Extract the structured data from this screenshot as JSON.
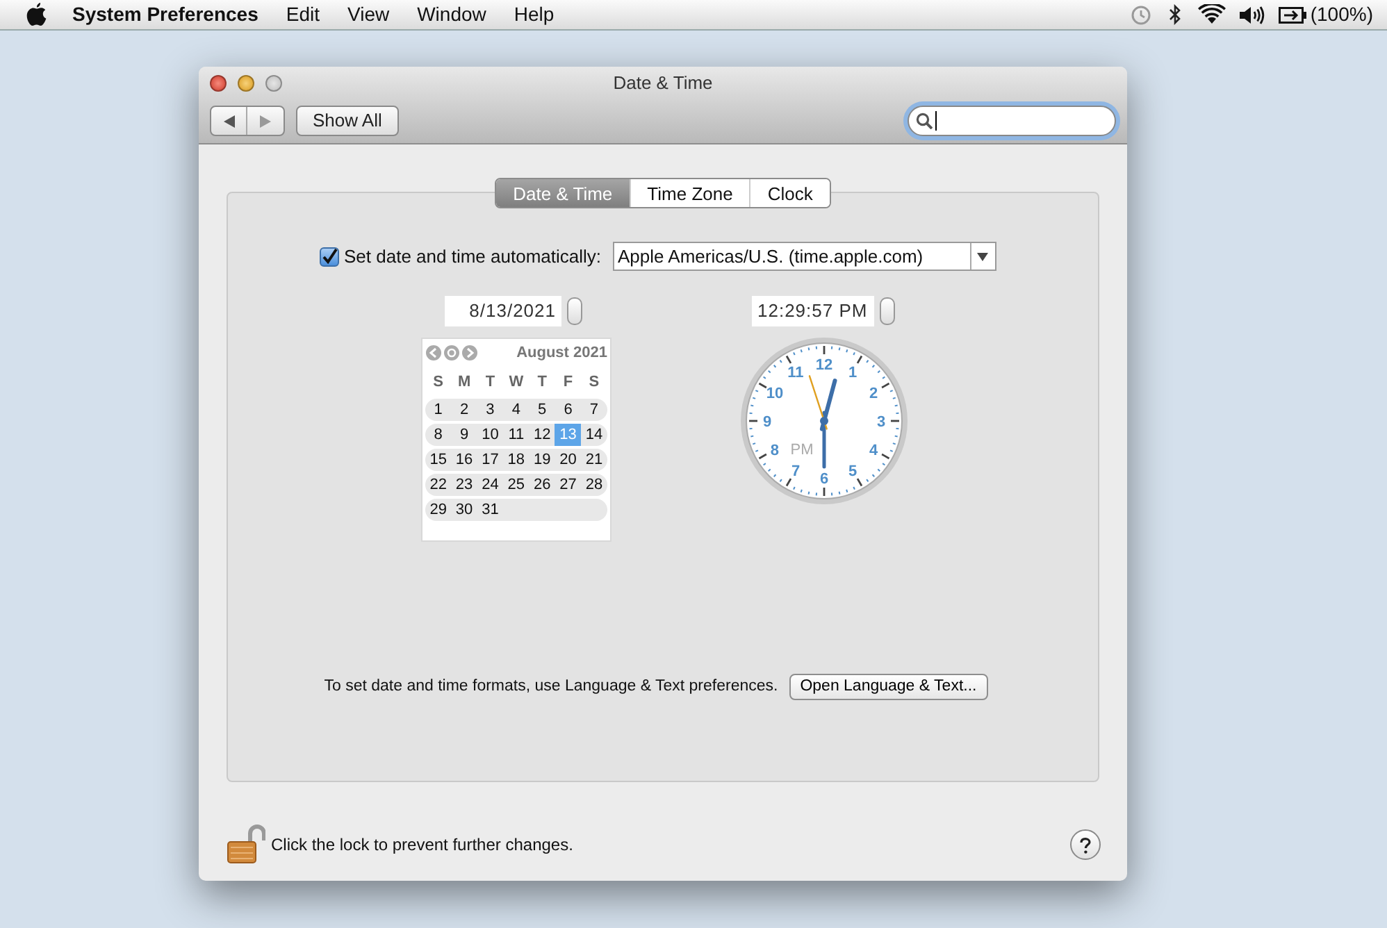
{
  "menubar": {
    "app_name": "System Preferences",
    "menus": [
      "Edit",
      "View",
      "Window",
      "Help"
    ],
    "battery_text": "(100%)"
  },
  "window": {
    "title": "Date & Time"
  },
  "toolbar": {
    "show_all": "Show All",
    "search_focused": true
  },
  "tabs": [
    {
      "label": "Date & Time",
      "selected": true
    },
    {
      "label": "Time Zone",
      "selected": false
    },
    {
      "label": "Clock",
      "selected": false
    }
  ],
  "auto_time": {
    "label": "Set date and time automatically:",
    "checked": true,
    "server": "Apple Americas/U.S. (time.apple.com)"
  },
  "date_field": "8/13/2021",
  "time_field": "12:29:57 PM",
  "calendar": {
    "month": "August 2021",
    "weekdays": [
      "S",
      "M",
      "T",
      "W",
      "T",
      "F",
      "S"
    ],
    "weeks": [
      [
        {
          "day": "1",
          "selected": false
        },
        {
          "day": "2",
          "selected": false
        },
        {
          "day": "3",
          "selected": false
        },
        {
          "day": "4",
          "selected": false
        },
        {
          "day": "5",
          "selected": false
        },
        {
          "day": "6",
          "selected": false
        },
        {
          "day": "7",
          "selected": false
        }
      ],
      [
        {
          "day": "8",
          "selected": false
        },
        {
          "day": "9",
          "selected": false
        },
        {
          "day": "10",
          "selected": false
        },
        {
          "day": "11",
          "selected": false
        },
        {
          "day": "12",
          "selected": false
        },
        {
          "day": "13",
          "selected": true
        },
        {
          "day": "14",
          "selected": false
        }
      ],
      [
        {
          "day": "15",
          "selected": false
        },
        {
          "day": "16",
          "selected": false
        },
        {
          "day": "17",
          "selected": false
        },
        {
          "day": "18",
          "selected": false
        },
        {
          "day": "19",
          "selected": false
        },
        {
          "day": "20",
          "selected": false
        },
        {
          "day": "21",
          "selected": false
        }
      ],
      [
        {
          "day": "22",
          "selected": false
        },
        {
          "day": "23",
          "selected": false
        },
        {
          "day": "24",
          "selected": false
        },
        {
          "day": "25",
          "selected": false
        },
        {
          "day": "26",
          "selected": false
        },
        {
          "day": "27",
          "selected": false
        },
        {
          "day": "28",
          "selected": false
        }
      ],
      [
        {
          "day": "29",
          "selected": false
        },
        {
          "day": "30",
          "selected": false
        },
        {
          "day": "31",
          "selected": false
        }
      ]
    ]
  },
  "clock": {
    "numerals": [
      "12",
      "1",
      "2",
      "3",
      "4",
      "5",
      "6",
      "7",
      "8",
      "9",
      "10",
      "11"
    ],
    "period": "PM"
  },
  "formats_note": "To set date and time formats, use Language & Text preferences.",
  "formats_button": "Open Language & Text...",
  "lock": {
    "text": "Click the lock to prevent further changes.",
    "locked": false
  }
}
